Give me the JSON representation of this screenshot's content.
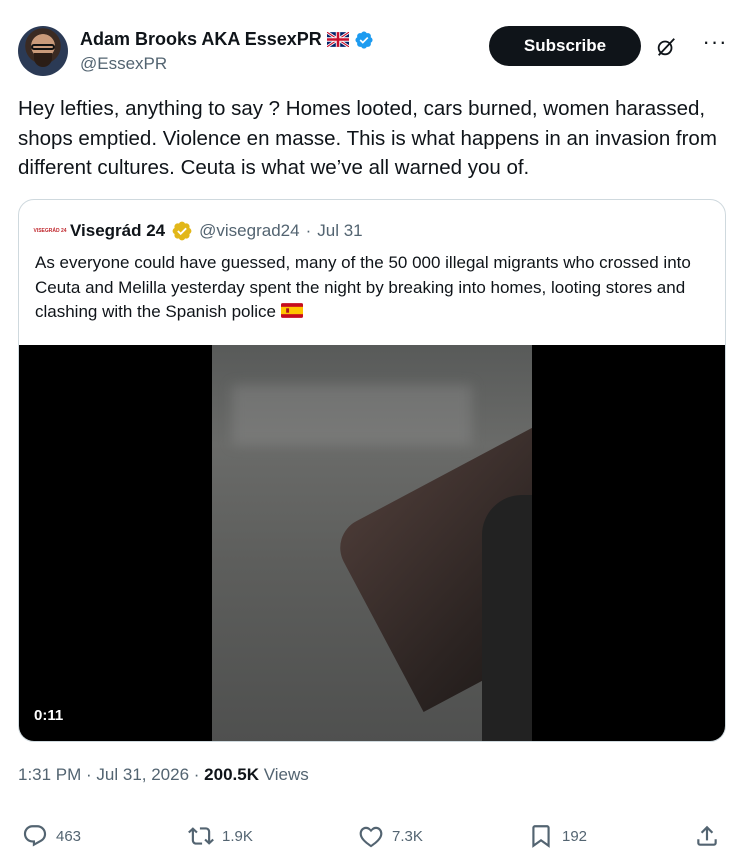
{
  "author": {
    "display_name": "Adam Brooks AKA EssexPR",
    "handle": "@EssexPR",
    "flag": "uk-flag-icon",
    "verified_color": "#1d9bf0"
  },
  "header": {
    "subscribe_label": "Subscribe",
    "grok_icon": "grok-icon",
    "more_icon": "more-icon",
    "more_glyph": "···"
  },
  "tweet": {
    "text": "Hey lefties, anything to say ? Homes looted, cars burned, women harassed, shops emptied. Violence en masse. This is what happens in an invasion from different cultures. Ceuta is what we’ve all warned you of."
  },
  "quote": {
    "avatar_text": "VISEGRÁD 24",
    "name": "Visegrád 24",
    "handle": "@visegrad24",
    "separator": "·",
    "date": "Jul 31",
    "text": "As everyone could have guessed, many of the 50 000 illegal migrants who crossed into Ceuta and Melilla yesterday spent the night by breaking into homes, looting stores and clashing with the Spanish police",
    "flag": "spain-flag-icon",
    "badge_color": "#e2b719",
    "video_timer": "0:11"
  },
  "meta": {
    "time": "1:31 PM",
    "sep1": " · ",
    "date": "Jul 31, 2026",
    "sep2": " · ",
    "views": "200.5K",
    "views_label": " Views"
  },
  "actions": {
    "replies": "463",
    "reposts": "1.9K",
    "likes": "7.3K",
    "bookmarks": "192"
  }
}
